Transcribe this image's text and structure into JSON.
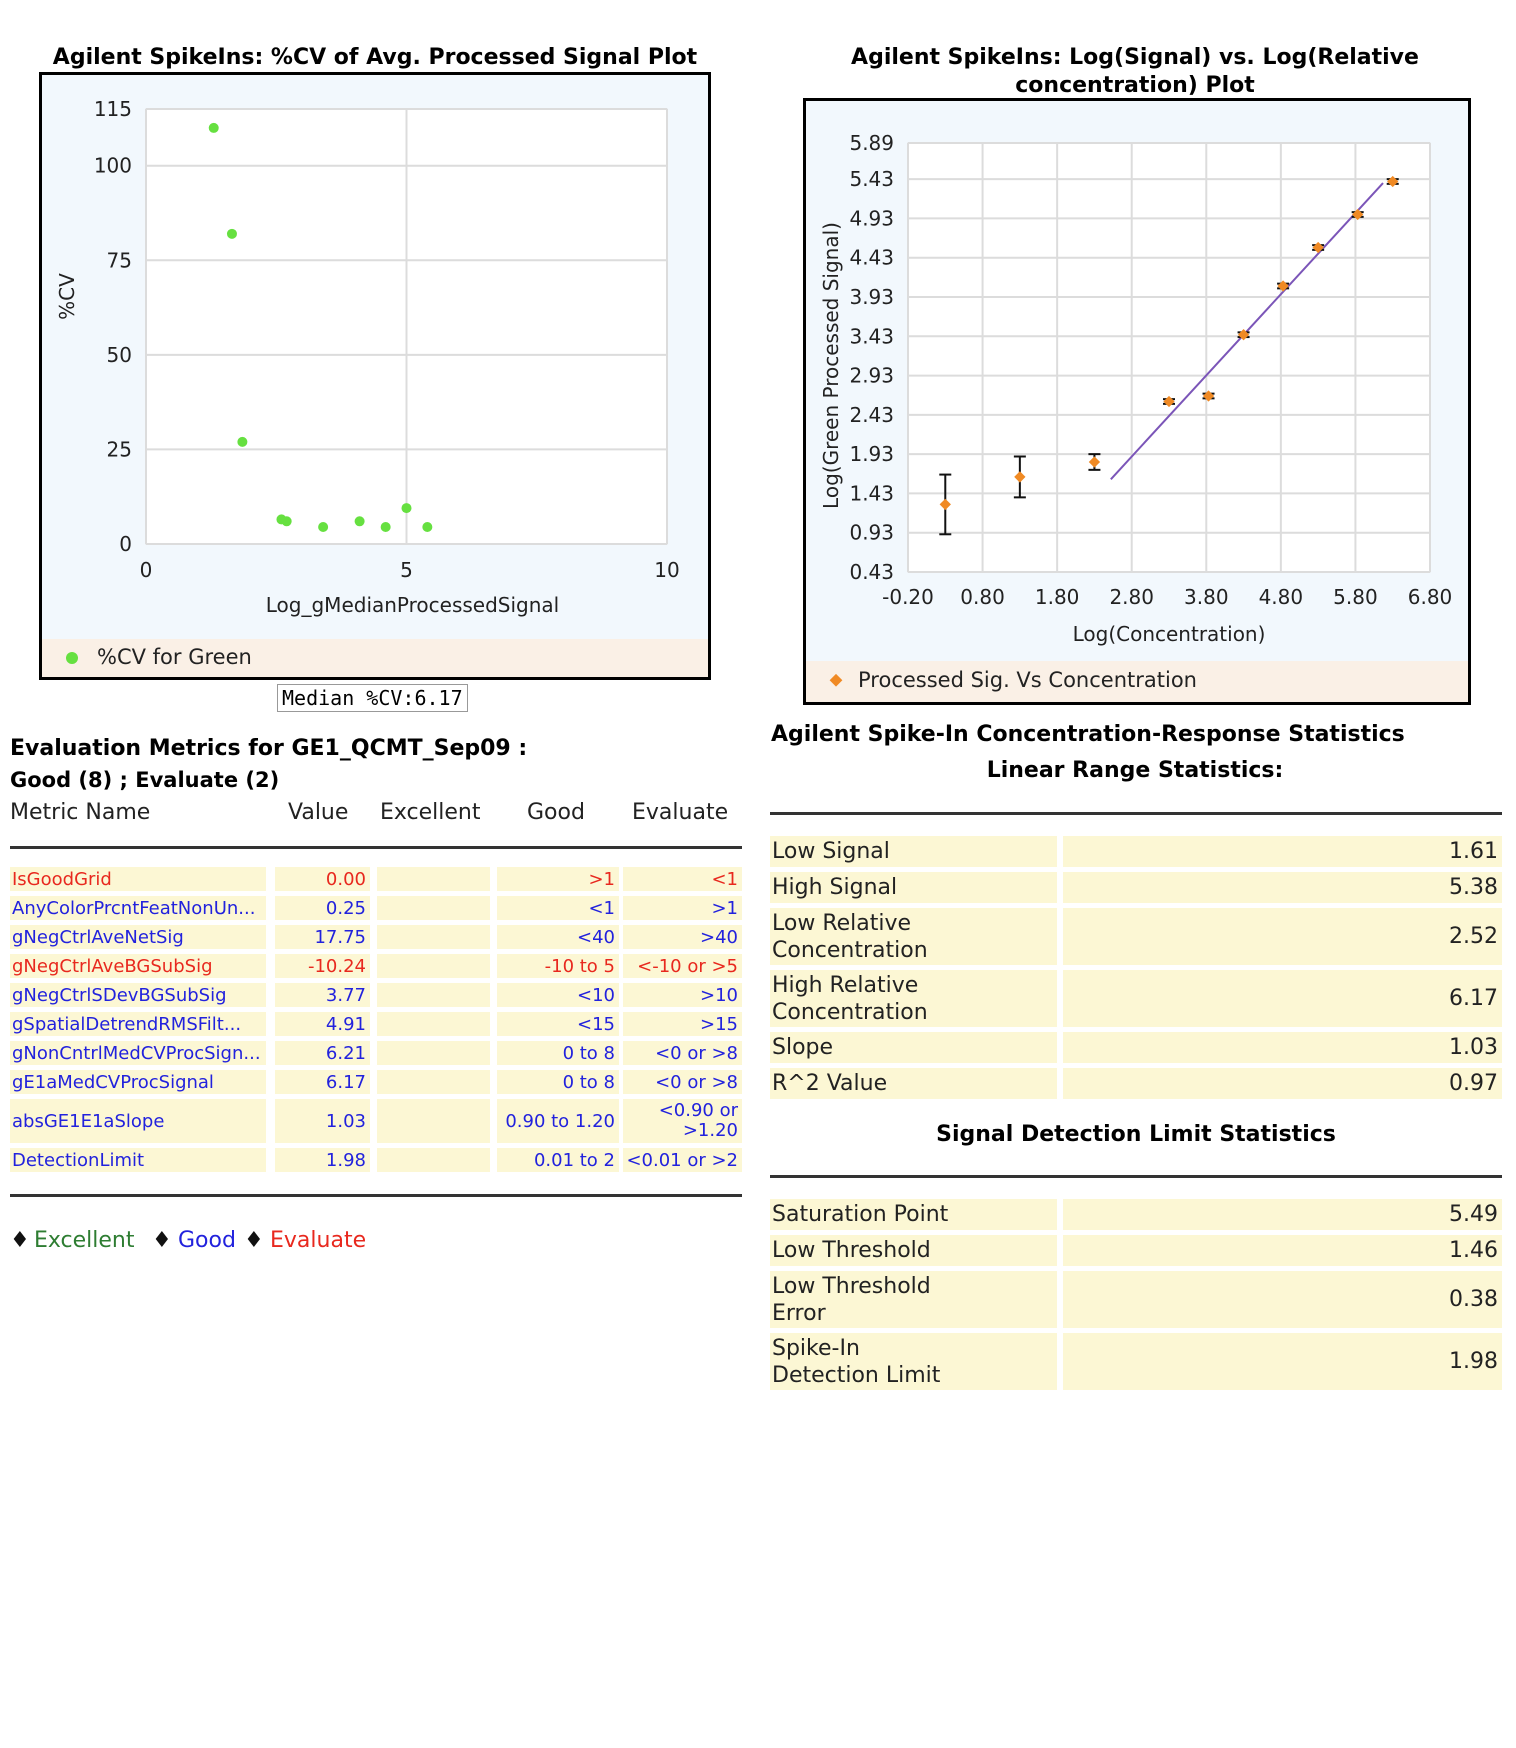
{
  "chart_data": [
    {
      "type": "scatter",
      "title": "Agilent SpikeIns: %CV of Avg. Processed Signal Plot",
      "xlabel": "Log_gMedianProcessedSignal",
      "ylabel": "%CV",
      "xlim": [
        0,
        10
      ],
      "ylim": [
        0,
        115
      ],
      "xticks": [
        "0",
        "5",
        "10"
      ],
      "yticks": [
        "0",
        "25",
        "50",
        "75",
        "100",
        "115"
      ],
      "grid": true,
      "legend_position": "bottom",
      "series": [
        {
          "name": "%CV for Green",
          "color": "#66e040",
          "points": [
            {
              "x": 1.3,
              "y": 110
            },
            {
              "x": 1.65,
              "y": 82
            },
            {
              "x": 1.85,
              "y": 27
            },
            {
              "x": 2.6,
              "y": 6.5
            },
            {
              "x": 2.7,
              "y": 6
            },
            {
              "x": 3.4,
              "y": 4.5
            },
            {
              "x": 4.1,
              "y": 6
            },
            {
              "x": 4.6,
              "y": 4.5
            },
            {
              "x": 5.0,
              "y": 9.5
            },
            {
              "x": 5.4,
              "y": 4.5
            }
          ]
        }
      ],
      "annotation": "Median %CV:6.17"
    },
    {
      "type": "scatter",
      "title": "Agilent SpikeIns: Log(Signal) vs. Log(Relative concentration) Plot",
      "xlabel": "Log(Concentration)",
      "ylabel": "Log(Green Processed Signal)",
      "xlim": [
        -0.2,
        6.8
      ],
      "ylim": [
        0.43,
        5.89
      ],
      "xticks": [
        "-0.20",
        "0.80",
        "1.80",
        "2.80",
        "3.80",
        "4.80",
        "5.80",
        "6.80"
      ],
      "yticks": [
        "0.43",
        "0.93",
        "1.43",
        "1.93",
        "2.43",
        "2.93",
        "3.43",
        "3.93",
        "4.43",
        "4.93",
        "5.43",
        "5.89"
      ],
      "grid": true,
      "legend_position": "bottom",
      "series": [
        {
          "name": "Processed Sig. Vs Concentration",
          "color": "#f08a24",
          "points": [
            {
              "x": 0.3,
              "y": 1.29,
              "err": 0.38
            },
            {
              "x": 1.3,
              "y": 1.64,
              "err": 0.26
            },
            {
              "x": 2.3,
              "y": 1.83,
              "err": 0.1
            },
            {
              "x": 3.3,
              "y": 2.6,
              "err": 0.03
            },
            {
              "x": 3.83,
              "y": 2.67,
              "err": 0.03
            },
            {
              "x": 4.3,
              "y": 3.45,
              "err": 0.03
            },
            {
              "x": 4.83,
              "y": 4.07,
              "err": 0.03
            },
            {
              "x": 5.3,
              "y": 4.56,
              "err": 0.03
            },
            {
              "x": 5.83,
              "y": 4.98,
              "err": 0.03
            },
            {
              "x": 6.3,
              "y": 5.4,
              "err": 0.03
            }
          ]
        }
      ],
      "fit_line": {
        "color": "#7b55b8",
        "x1": 2.52,
        "y1": 1.61,
        "x2": 6.17,
        "y2": 5.38
      }
    }
  ],
  "eval": {
    "title": "Evaluation Metrics for GE1_QCMT_Sep09 :",
    "subtitle": "Good (8) ; Evaluate (2)",
    "headers": {
      "name": "Metric Name",
      "value": "Value",
      "excellent": "Excellent",
      "good": "Good",
      "evaluate": "Evaluate"
    },
    "rows": [
      {
        "name": "IsGoodGrid",
        "value": "0.00",
        "excellent": "",
        "good": ">1",
        "evaluate": "<1",
        "color": "#e8281e"
      },
      {
        "name": "AnyColorPrcntFeatNonUn...",
        "value": "0.25",
        "excellent": "",
        "good": "<1",
        "evaluate": ">1",
        "color": "#2222dd"
      },
      {
        "name": "gNegCtrlAveNetSig",
        "value": "17.75",
        "excellent": "",
        "good": "<40",
        "evaluate": ">40",
        "color": "#2222dd"
      },
      {
        "name": "gNegCtrlAveBGSubSig",
        "value": "-10.24",
        "excellent": "",
        "good": "-10 to 5",
        "evaluate": "<-10 or >5",
        "color": "#e8281e"
      },
      {
        "name": "gNegCtrlSDevBGSubSig",
        "value": "3.77",
        "excellent": "",
        "good": "<10",
        "evaluate": ">10",
        "color": "#2222dd"
      },
      {
        "name": "gSpatialDetrendRMSFilt...",
        "value": "4.91",
        "excellent": "",
        "good": "<15",
        "evaluate": ">15",
        "color": "#2222dd"
      },
      {
        "name": "gNonCntrlMedCVProcSign...",
        "value": "6.21",
        "excellent": "",
        "good": "0 to 8",
        "evaluate": "<0 or >8",
        "color": "#2222dd"
      },
      {
        "name": "gE1aMedCVProcSignal",
        "value": "6.17",
        "excellent": "",
        "good": "0 to 8",
        "evaluate": "<0 or >8",
        "color": "#2222dd"
      },
      {
        "name": "absGE1E1aSlope",
        "value": "1.03",
        "excellent": "",
        "good": "0.90 to 1.20",
        "evaluate": "<0.90 or >1.20",
        "color": "#2222dd"
      },
      {
        "name": "DetectionLimit",
        "value": "1.98",
        "excellent": "",
        "good": "0.01 to 2",
        "evaluate": "<0.01 or >2",
        "color": "#2222dd"
      }
    ],
    "key": {
      "diamond": "♦",
      "excellent": "Excellent",
      "good": "Good",
      "evaluate": "Evaluate",
      "excellent_color": "#2e7d32",
      "good_color": "#2222dd",
      "evaluate_color": "#e8281e"
    }
  },
  "stats": {
    "title": "Agilent Spike-In Concentration-Response Statistics",
    "linear_title": "Linear Range Statistics:",
    "linear": [
      {
        "label": "Low Signal",
        "value": "1.61"
      },
      {
        "label": "High Signal",
        "value": "5.38"
      },
      {
        "label": "Low Relative Concentration",
        "value": "2.52"
      },
      {
        "label": "High Relative Concentration",
        "value": "6.17"
      },
      {
        "label": "Slope",
        "value": "1.03"
      },
      {
        "label": "R^2 Value",
        "value": "0.97"
      }
    ],
    "detect_title": "Signal Detection Limit Statistics",
    "detect": [
      {
        "label": "Saturation Point",
        "value": "5.49"
      },
      {
        "label": "Low Threshold",
        "value": "1.46"
      },
      {
        "label": "Low Threshold Error",
        "value": "0.38"
      },
      {
        "label": "Spike-In Detection Limit",
        "value": "1.98"
      }
    ]
  }
}
